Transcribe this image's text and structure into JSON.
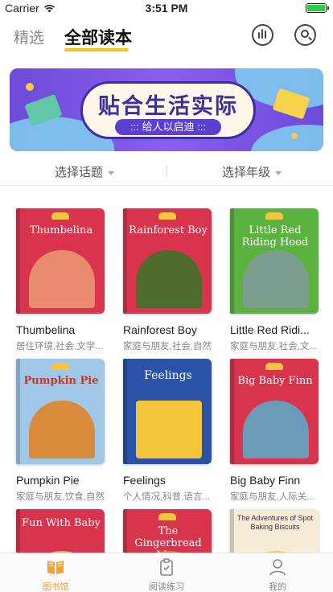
{
  "status_bar": {
    "carrier": "Carrier",
    "time": "3:51 PM"
  },
  "nav": {
    "tab_featured": "精选",
    "tab_all": "全部读本"
  },
  "banner": {
    "title": "贴合生活实际",
    "subtitle": "给人以启迪"
  },
  "filters": {
    "topic": "选择话题",
    "grade": "选择年级"
  },
  "books": [
    {
      "title": "Thumbelina",
      "tags": "居住环境,社会,文学...",
      "cover_title": "Thumbelina",
      "cover_color": "#d8344e",
      "art_color": "#e98b6f"
    },
    {
      "title": "Rainforest Boy",
      "tags": "家庭与朋友,社会,自然",
      "cover_title": "Rainforest Boy",
      "cover_color": "#d8344e",
      "art_color": "#4f6b2e"
    },
    {
      "title": "Little Red Ridi...",
      "tags": "家庭与朋友,社会,文...",
      "cover_title": "Little Red Riding Hood",
      "cover_color": "#5cb23f",
      "art_color": "#7c9e8f"
    },
    {
      "title": "Pumpkin Pie",
      "tags": "家庭与朋友,饮食,自然",
      "cover_title": "Pumpkin Pie",
      "cover_color": "#9fc7e8",
      "art_color": "#d98a3b"
    },
    {
      "title": "Feelings",
      "tags": "个人情况,科普,语言...",
      "cover_title": "Feelings",
      "cover_color": "#2a53a8",
      "art_color": "#f3c43c"
    },
    {
      "title": "Big Baby Finn",
      "tags": "家庭与朋友,人际关...",
      "cover_title": "Big Baby Finn",
      "cover_color": "#d8344e",
      "art_color": "#6c9bb8"
    },
    {
      "title": "",
      "tags": "",
      "cover_title": "Fun With Baby",
      "cover_color": "#d8344e",
      "art_color": "#e6a97a"
    },
    {
      "title": "",
      "tags": "",
      "cover_title": "The Gingerbread Man",
      "cover_color": "#d8344e",
      "art_color": "#c9884a"
    },
    {
      "title": "",
      "tags": "",
      "cover_title": "The Adventures of Spot Baking Biscuits",
      "cover_color": "#f6ecd6",
      "art_color": "#e8c98a"
    }
  ],
  "tabbar": {
    "library": "图书馆",
    "practice": "阅读练习",
    "mine": "我的",
    "active_color": "#f2a23a"
  }
}
